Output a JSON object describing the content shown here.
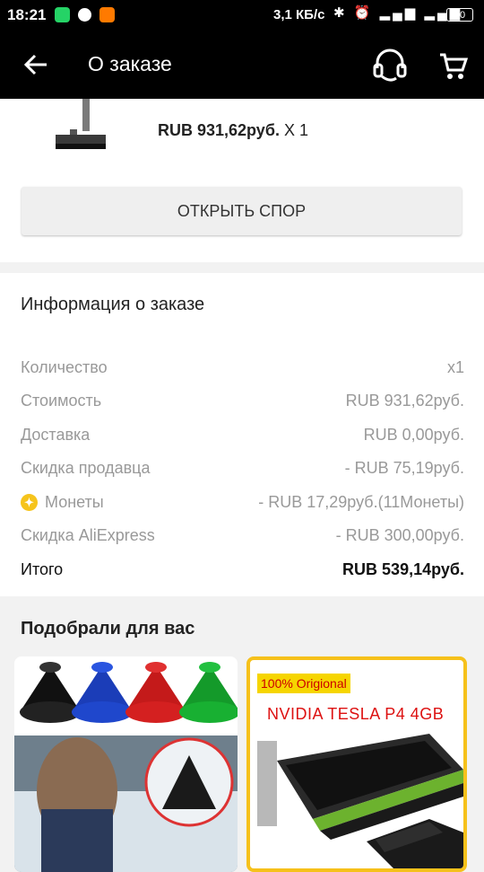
{
  "status_bar": {
    "time": "18:21",
    "speed": "3,1 КБ/с",
    "right_icons": "✱ ⏰ ▂▄▆ ▂▄▆",
    "battery": "30"
  },
  "toolbar": {
    "title": "О заказе"
  },
  "product": {
    "price": "RUB 931,62руб.",
    "qty": "X 1"
  },
  "dispute_button": "ОТКРЫТЬ СПОР",
  "order_info": {
    "title": "Информация о заказе",
    "rows": [
      {
        "label": "Количество",
        "value": "x1"
      },
      {
        "label": "Стоимость",
        "value": "RUB 931,62руб."
      },
      {
        "label": "Доставка",
        "value": "RUB 0,00руб."
      },
      {
        "label": "Скидка продавца",
        "value": "- RUB 75,19руб."
      },
      {
        "label": "Монеты",
        "value": "- RUB 17,29руб.(11Монеты)"
      },
      {
        "label": "Скидка AliExpress",
        "value": "- RUB 300,00руб."
      }
    ],
    "total": {
      "label": "Итого",
      "value": "RUB 539,14руб."
    }
  },
  "recommendations": {
    "title": "Подобрали для вас",
    "items": [
      {
        "badge": "",
        "name": "",
        "icon": "ice-scraper-cones-image"
      },
      {
        "badge": "100% Origional",
        "name": "NVIDIA TESLA P4 4GB",
        "icon": "gpu-card-image"
      }
    ]
  },
  "colors": {
    "accent_yellow": "#f6c11b",
    "badge_red": "#cc0000"
  }
}
